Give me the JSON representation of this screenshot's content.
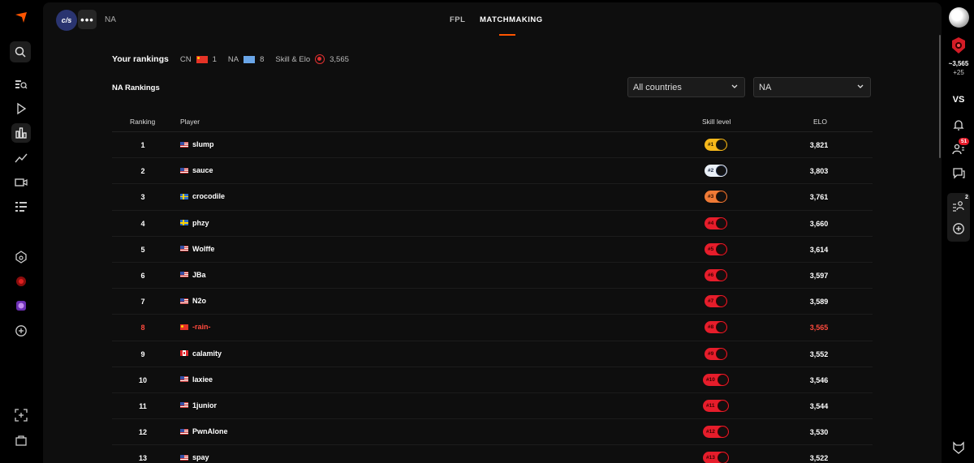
{
  "topbar": {
    "org_logo_text": "c/s",
    "more_label": "•••",
    "region": "NA",
    "tabs": [
      {
        "label": "FPL",
        "active": false
      },
      {
        "label": "MATCHMAKING",
        "active": true
      }
    ],
    "accent_color": "#ff5500"
  },
  "your_rankings": {
    "title": "Your rankings",
    "country_code": "CN",
    "country_rank": "1",
    "region_code": "NA",
    "region_rank": "8",
    "skill_label": "Skill & Elo",
    "elo": "3,565"
  },
  "section_title": "NA Rankings",
  "filters": {
    "country": "All countries",
    "region": "NA"
  },
  "table": {
    "headers": {
      "ranking": "Ranking",
      "player": "Player",
      "skill": "Skill level",
      "elo": "ELO"
    },
    "rows": [
      {
        "rank": "1",
        "flag": "us",
        "player": "slump",
        "badge": "#1",
        "tier": "gold",
        "elo": "3,821"
      },
      {
        "rank": "2",
        "flag": "us",
        "player": "sauce",
        "badge": "#2",
        "tier": "silver",
        "elo": "3,803"
      },
      {
        "rank": "3",
        "flag": "se",
        "player": "crocodile",
        "badge": "#3",
        "tier": "bronze",
        "elo": "3,761"
      },
      {
        "rank": "4",
        "flag": "se",
        "player": "phzy",
        "badge": "#4",
        "tier": "red",
        "elo": "3,660"
      },
      {
        "rank": "5",
        "flag": "us",
        "player": "Wolffe",
        "badge": "#5",
        "tier": "red",
        "elo": "3,614"
      },
      {
        "rank": "6",
        "flag": "us",
        "player": "JBa",
        "badge": "#6",
        "tier": "red",
        "elo": "3,597"
      },
      {
        "rank": "7",
        "flag": "us",
        "player": "N2o",
        "badge": "#7",
        "tier": "red",
        "elo": "3,589"
      },
      {
        "rank": "8",
        "flag": "cn",
        "player": "-rain-",
        "badge": "#8",
        "tier": "red",
        "elo": "3,565",
        "me": true
      },
      {
        "rank": "9",
        "flag": "ca",
        "player": "calamity",
        "badge": "#9",
        "tier": "red",
        "elo": "3,552"
      },
      {
        "rank": "10",
        "flag": "us",
        "player": "laxiee",
        "badge": "#10",
        "tier": "red",
        "elo": "3,546"
      },
      {
        "rank": "11",
        "flag": "us",
        "player": "1junior",
        "badge": "#11",
        "tier": "red",
        "elo": "3,544"
      },
      {
        "rank": "12",
        "flag": "us",
        "player": "PwnAlone",
        "badge": "#12",
        "tier": "red",
        "elo": "3,530"
      },
      {
        "rank": "13",
        "flag": "us",
        "player": "spay",
        "badge": "#13",
        "tier": "red",
        "elo": "3,522"
      }
    ]
  },
  "right_bar": {
    "elo": "~3,565",
    "elo_delta": "+25",
    "vs_label": "VS",
    "friends_badge": "51",
    "party_badge": "2"
  },
  "left_bar": {
    "icons": [
      "faceit-logo-icon",
      "search-icon",
      "lobby-search-icon",
      "play-icon",
      "rankings-icon",
      "stats-icon",
      "watch-icon",
      "missions-icon",
      "hub-icon",
      "org-icon",
      "club-icon",
      "add-icon",
      "create-icon",
      "shop-icon"
    ]
  }
}
